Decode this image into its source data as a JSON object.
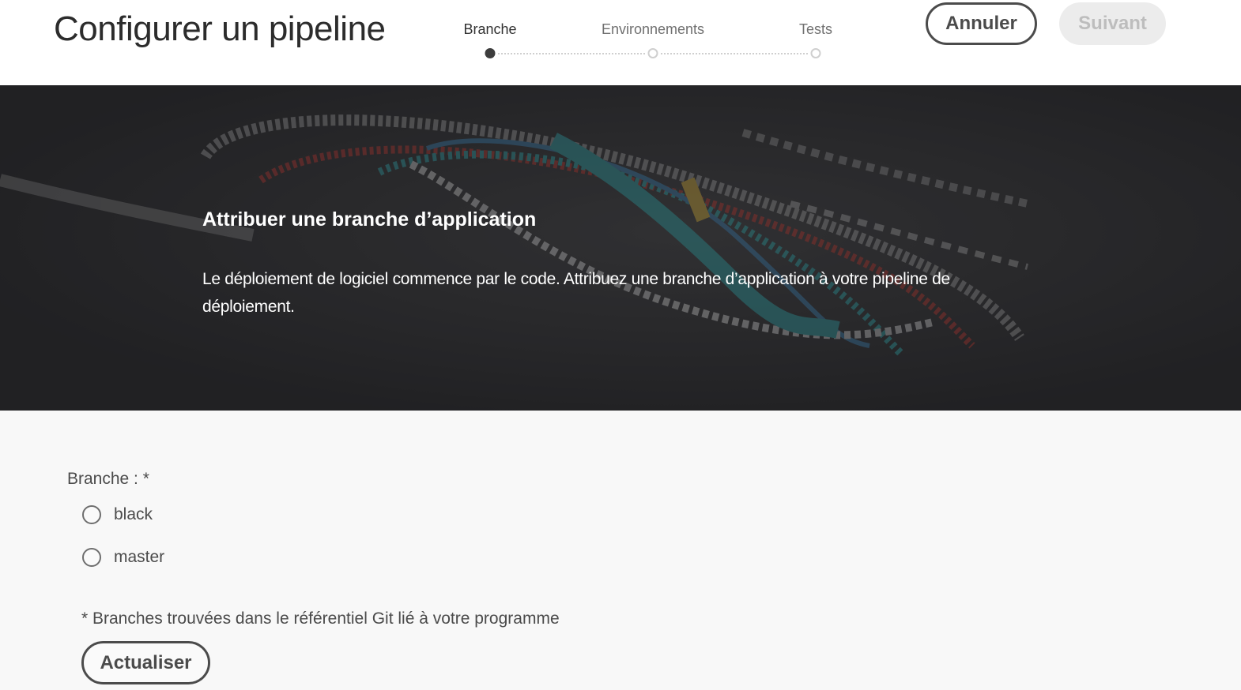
{
  "header": {
    "title": "Configurer un pipeline",
    "steps": [
      {
        "label": "Branche",
        "state": "active"
      },
      {
        "label": "Environnements",
        "state": "pending"
      },
      {
        "label": "Tests",
        "state": "pending"
      }
    ],
    "cancel_label": "Annuler",
    "next_label": "Suivant"
  },
  "hero": {
    "title": "Attribuer une branche d’application",
    "description": "Le déploiement de logiciel commence par le code. Attribuez une branche d’application à votre pipeline de déploiement."
  },
  "form": {
    "branch_label": "Branche : *",
    "options": [
      {
        "label": "black",
        "selected": false
      },
      {
        "label": "master",
        "selected": false
      }
    ],
    "hint": "* Branches trouvées dans le référentiel Git lié à votre programme",
    "refresh_label": "Actualiser"
  },
  "colors": {
    "hero_bg": "#2b2b2d",
    "hero_accent_teal": "#2fa4a8",
    "hero_accent_red": "#b7372f",
    "button_border": "#4b4b4b",
    "disabled_bg": "#ececec"
  }
}
